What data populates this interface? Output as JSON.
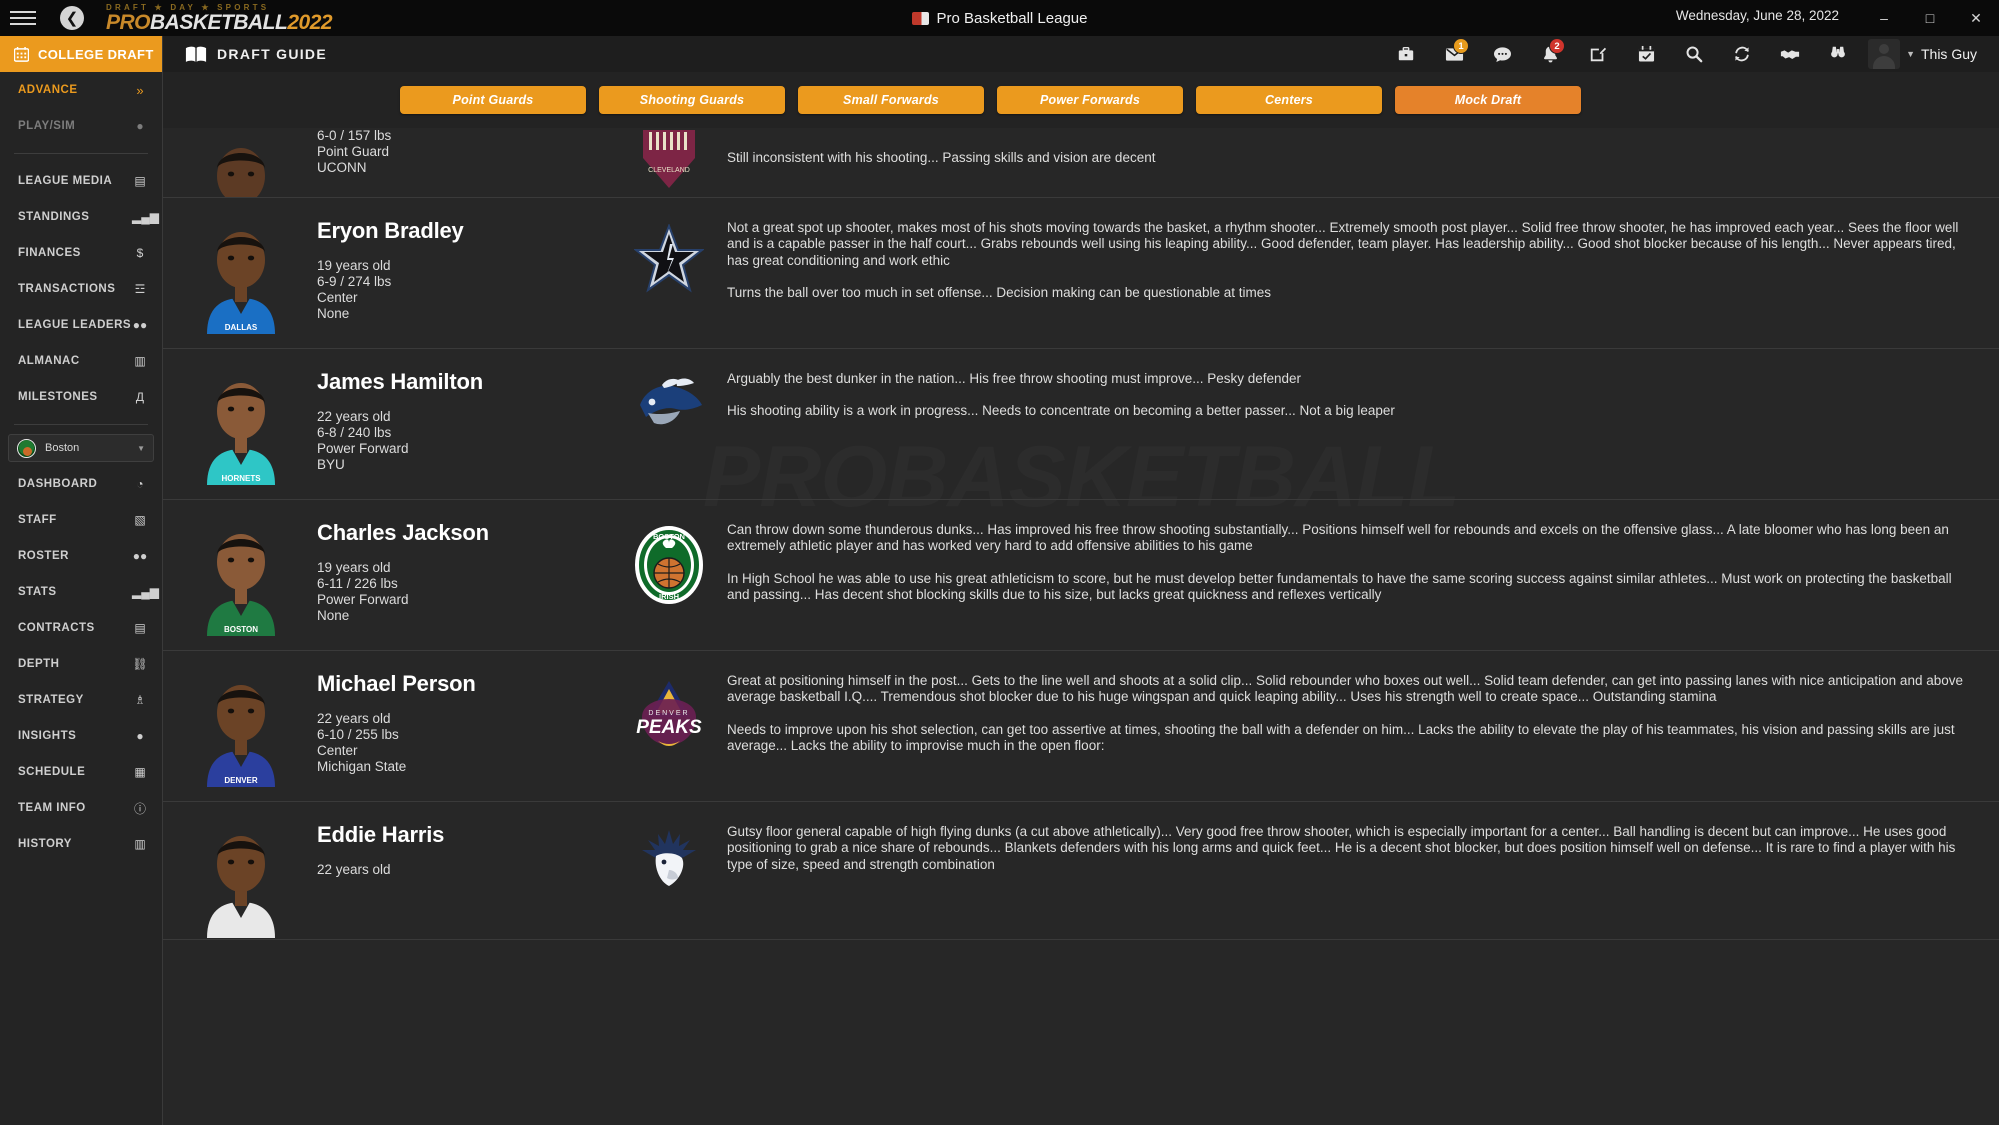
{
  "titlebar": {
    "back_icon": "back-arrow-icon",
    "menu_icon": "hamburger-icon",
    "logo_sub": "DRAFT ★ DAY ★ SPORTS",
    "logo_pro": "PRO",
    "logo_basketball": "BASKETBALL",
    "logo_year": "2022",
    "window_title": "Pro Basketball League",
    "date": "Wednesday, June 28, 2022",
    "minimize": "–",
    "maximize": "□",
    "close": "✕"
  },
  "sidebar": {
    "header": {
      "label": "COLLEGE DRAFT",
      "icon": "calendar-icon"
    },
    "top_items": [
      {
        "label": "ADVANCE",
        "icon": "»",
        "state": "accent"
      },
      {
        "label": "PLAY/SIM",
        "icon": "●",
        "state": "dim"
      }
    ],
    "league_items": [
      {
        "label": "LEAGUE MEDIA",
        "icon": "▤"
      },
      {
        "label": "STANDINGS",
        "icon": "▂▄▆"
      },
      {
        "label": "FINANCES",
        "icon": "$"
      },
      {
        "label": "TRANSACTIONS",
        "icon": "☲"
      },
      {
        "label": "LEAGUE LEADERS",
        "icon": "●●"
      },
      {
        "label": "ALMANAC",
        "icon": "▥"
      },
      {
        "label": "MILESTONES",
        "icon": "Д"
      }
    ],
    "team": {
      "name": "Boston",
      "caret": "▼",
      "logo": "boston-irish-logo"
    },
    "team_items": [
      {
        "label": "DASHBOARD",
        "icon": "◔"
      },
      {
        "label": "STAFF",
        "icon": "▧"
      },
      {
        "label": "ROSTER",
        "icon": "●●"
      },
      {
        "label": "STATS",
        "icon": "▂▄▆"
      },
      {
        "label": "CONTRACTS",
        "icon": "▤"
      },
      {
        "label": "DEPTH",
        "icon": "⛓"
      },
      {
        "label": "STRATEGY",
        "icon": "♗"
      },
      {
        "label": "INSIGHTS",
        "icon": "●"
      },
      {
        "label": "SCHEDULE",
        "icon": "▦"
      },
      {
        "label": "TEAM INFO",
        "icon": "ⓘ"
      },
      {
        "label": "HISTORY",
        "icon": "▥"
      }
    ]
  },
  "topbar": {
    "guide_label": "DRAFT GUIDE",
    "guide_icon": "book-icon",
    "icons": [
      {
        "name": "briefcase-icon",
        "glyph": "⛁",
        "badge": null,
        "badge_color": null
      },
      {
        "name": "mail-icon",
        "glyph": "✉",
        "badge": "1",
        "badge_color": "#e79b1d"
      },
      {
        "name": "chat-icon",
        "glyph": "●",
        "badge": null,
        "badge_color": null
      },
      {
        "name": "bell-icon",
        "glyph": "ὑ4",
        "badge": "2",
        "badge_color": "#d0342c"
      },
      {
        "name": "compose-icon",
        "glyph": "✎",
        "badge": null,
        "badge_color": null
      },
      {
        "name": "calendar-check-icon",
        "glyph": "▦",
        "badge": null,
        "badge_color": null
      },
      {
        "name": "search-icon",
        "glyph": "⚲",
        "badge": null,
        "badge_color": null
      },
      {
        "name": "refresh-icon",
        "glyph": "↻",
        "badge": null,
        "badge_color": null
      },
      {
        "name": "handshake-icon",
        "glyph": "✋",
        "badge": null,
        "badge_color": null
      },
      {
        "name": "binoculars-icon",
        "glyph": "●●",
        "badge": null,
        "badge_color": null
      }
    ],
    "user_name": "This Guy",
    "user_caret": "▼"
  },
  "tabs": [
    {
      "label": "Point Guards",
      "active": false
    },
    {
      "label": "Shooting Guards",
      "active": false
    },
    {
      "label": "Small Forwards",
      "active": false
    },
    {
      "label": "Power Forwards",
      "active": false
    },
    {
      "label": "Centers",
      "active": false
    },
    {
      "label": "Mock Draft",
      "active": true
    }
  ],
  "watermark": "PROBASKETBALL",
  "players": [
    {
      "name": "",
      "age": "",
      "measurements": "6-0 / 157 lbs",
      "position": "Point Guard",
      "school": "UCONN",
      "team_logo": "cleveland-logo",
      "jersey_label": "CLEVELAND",
      "jersey_color": "#a8374e",
      "skin": "#5c3a24",
      "pros": "Still inconsistent with his shooting... Passing skills and vision are decent",
      "cons": ""
    },
    {
      "name": "Eryon Bradley",
      "age": "19 years old",
      "measurements": "6-9 / 274 lbs",
      "position": "Center",
      "school": "None",
      "team_logo": "dallas-star-logo",
      "jersey_label": "DALLAS",
      "jersey_color": "#1a6fc4",
      "skin": "#6b4326",
      "pros": "Not a great spot up shooter, makes most of his shots moving towards the basket, a rhythm shooter... Extremely smooth post player... Solid free throw shooter, he has improved each year... Sees the floor well and is a capable passer in the half court... Grabs rebounds well using his leaping ability... Good defender, team player. Has leadership ability... Good shot blocker because of his length... Never appears tired, has great conditioning and work ethic",
      "cons": "Turns the ball over too much in set offense... Decision making can be questionable at times"
    },
    {
      "name": "James Hamilton",
      "age": "22 years old",
      "measurements": "6-8 / 240 lbs",
      "position": "Power Forward",
      "school": "BYU",
      "team_logo": "hornets-logo",
      "jersey_label": "HORNETS",
      "jersey_color": "#2ec6c6",
      "skin": "#8a5a38",
      "pros": "Arguably the best dunker in the nation... His free throw shooting must improve... Pesky defender",
      "cons": "His shooting ability is a work in progress... Needs to concentrate on becoming a better passer... Not a big leaper"
    },
    {
      "name": "Charles Jackson",
      "age": "19 years old",
      "measurements": "6-11 / 226 lbs",
      "position": "Power Forward",
      "school": "None",
      "team_logo": "boston-irish-logo",
      "jersey_label": "BOSTON",
      "jersey_color": "#1f7a42",
      "skin": "#8a5a38",
      "pros": "Can throw down some thunderous dunks... Has improved his free throw shooting substantially... Positions himself well for rebounds and excels on the offensive glass... A late bloomer who has long been an extremely athletic player and has worked very hard to add offensive abilities to his game",
      "cons": "In High School he was able to use his great athleticism to score, but he must develop better fundamentals to have the same scoring success against similar athletes... Must work on protecting the basketball and passing... Has decent shot blocking skills due to his size, but lacks great quickness and reflexes vertically"
    },
    {
      "name": "Michael Person",
      "age": "22 years old",
      "measurements": "6-10 / 255 lbs",
      "position": "Center",
      "school": "Michigan State",
      "team_logo": "denver-peaks-logo",
      "jersey_label": "DENVER",
      "jersey_color": "#2b3f9e",
      "skin": "#6b4326",
      "pros": "Great at positioning himself in the post... Gets to the line well and shoots at a solid clip... Solid rebounder who boxes out well... Solid team defender, can get into passing lanes with nice anticipation and above average basketball I.Q.... Tremendous shot blocker due to his huge wingspan and quick leaping ability... Uses his strength well to create space... Outstanding stamina",
      "cons": "Needs to improve upon his shot selection, can get too assertive at times, shooting the ball with a defender on him... Lacks the ability to elevate the play of his teammates, his vision and passing skills are just average... Lacks the ability to improvise much in the open floor:"
    },
    {
      "name": "Eddie Harris",
      "age": "22 years old",
      "measurements": "",
      "position": "",
      "school": "",
      "team_logo": "eagle-logo",
      "jersey_label": "",
      "jersey_color": "#e8e8e8",
      "skin": "#6b4326",
      "pros": "Gutsy floor general capable of high flying dunks (a cut above athletically)... Very good free throw shooter, which is especially important for a center... Ball handling is decent but can improve... He uses good positioning to grab a nice share of rebounds... Blankets defenders with his long arms and quick feet... He is a decent shot blocker, but does position himself well on defense... It is rare to find a player with his type of size, speed and strength combination",
      "cons": ""
    }
  ]
}
